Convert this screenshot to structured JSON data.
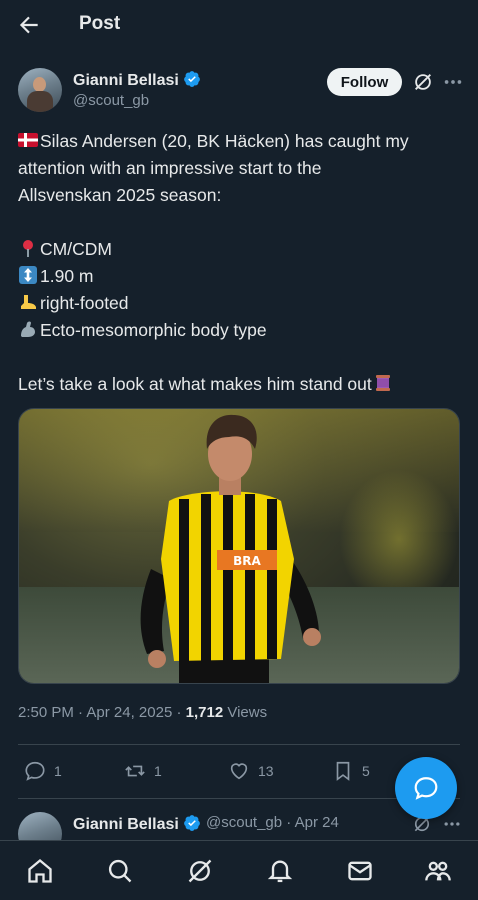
{
  "header": {
    "title": "Post",
    "back_icon": "arrow-left-icon"
  },
  "author": {
    "name": "Gianni Bellasi",
    "handle": "@scout_gb",
    "verified": true,
    "follow_label": "Follow"
  },
  "post": {
    "lines": [
      "Silas Andersen (20, BK Häcken) has caught my",
      "attention with an impressive start to the",
      "Allsvenskan 2025 season:",
      "",
      "CM/CDM",
      "1.90 m",
      "right-footed",
      "Ecto-mesomorphic body type",
      "",
      "Let’s take a look at what makes him stand out"
    ],
    "image_alt": "Football player in yellow and black striped BK Häcken kit"
  },
  "meta": {
    "time": "2:50 PM",
    "date": "Apr 24, 2025",
    "views_count": "1,712",
    "views_label": "Views"
  },
  "actions": {
    "replies": "1",
    "reposts": "1",
    "likes": "13",
    "bookmarks": "5"
  },
  "reply_preview": {
    "name": "Gianni Bellasi",
    "handle_date": "@scout_gb · Apr 24"
  },
  "colors": {
    "background": "#15202b",
    "accent": "#1d9bf0",
    "text": "#e7e9ea",
    "secondary": "#8b98a5"
  }
}
